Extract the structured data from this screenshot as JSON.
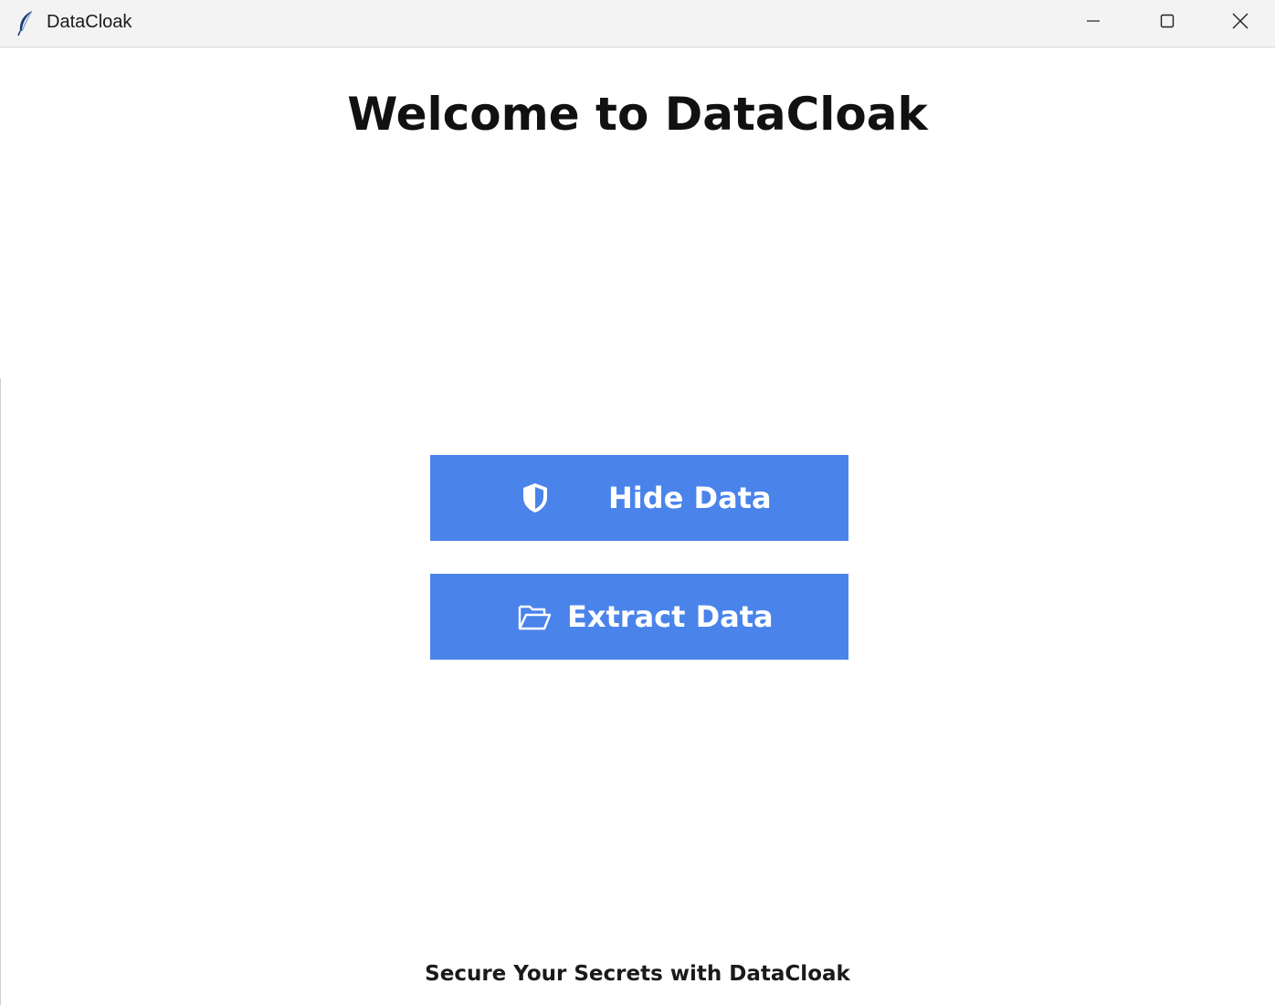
{
  "window": {
    "title": "DataCloak",
    "app_icon": "feather-icon",
    "controls": [
      "minimize-icon",
      "maximize-icon",
      "close-icon"
    ]
  },
  "main": {
    "heading": "Welcome to DataCloak",
    "buttons": [
      {
        "label": "Hide Data",
        "icon": "shield-icon"
      },
      {
        "label": "Extract Data",
        "icon": "folder-open-icon"
      }
    ],
    "footer": "Secure Your Secrets with DataCloak"
  },
  "colors": {
    "button_bg": "#4a84ea",
    "button_text": "#ffffff",
    "titlebar_bg": "#f3f3f3",
    "background": "#ffffff"
  }
}
